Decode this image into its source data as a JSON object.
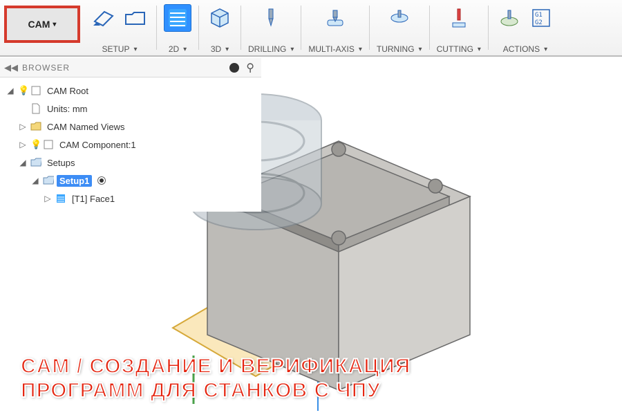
{
  "workspace": {
    "label": "CAM"
  },
  "toolbar": {
    "setup": "SETUP",
    "two_d": "2D",
    "three_d": "3D",
    "drilling": "DRILLING",
    "multi_axis": "MULTI-AXIS",
    "turning": "TURNING",
    "cutting": "CUTTING",
    "actions": "ACTIONS"
  },
  "browser": {
    "title": "BROWSER",
    "root": "CAM Root",
    "units": "Units: mm",
    "named_views": "CAM Named Views",
    "component": "CAM Component:1",
    "setups": "Setups",
    "setup1": "Setup1",
    "op1": "[T1] Face1"
  },
  "overlay": {
    "line1": "CAM / СОЗДАНИЕ И ВЕРИФИКАЦИЯ",
    "line2": "ПРОГРАММ ДЛЯ СТАНКОВ С ЧПУ"
  }
}
